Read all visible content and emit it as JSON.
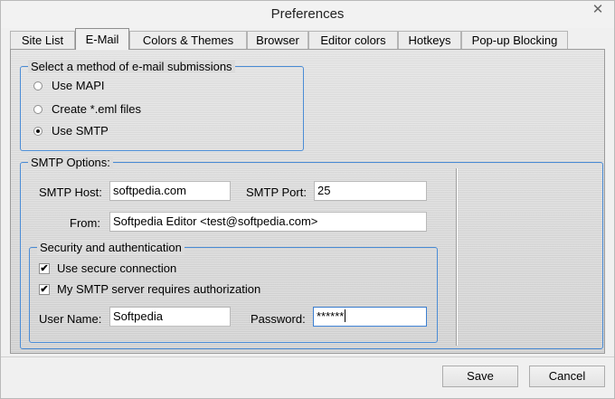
{
  "window": {
    "title": "Preferences",
    "close_glyph": "✕"
  },
  "tabs": [
    {
      "label": "Site List"
    },
    {
      "label": "E-Mail"
    },
    {
      "label": "Colors & Themes"
    },
    {
      "label": "Browser"
    },
    {
      "label": "Editor colors"
    },
    {
      "label": "Hotkeys"
    },
    {
      "label": "Pop-up Blocking"
    }
  ],
  "active_tab": "E-Mail",
  "method_group": {
    "legend": "Select a method of e-mail submissions",
    "options": [
      {
        "label": "Use MAPI",
        "selected": false
      },
      {
        "label": "Create *.eml files",
        "selected": false
      },
      {
        "label": "Use SMTP",
        "selected": true
      }
    ]
  },
  "smtp": {
    "legend": "SMTP Options:",
    "host_label": "SMTP Host:",
    "host_value": "softpedia.com",
    "port_label": "SMTP Port:",
    "port_value": "25",
    "from_label": "From:",
    "from_value": "Softpedia Editor <test@softpedia.com>"
  },
  "security": {
    "legend": "Security and authentication",
    "secure_label": "Use secure connection",
    "secure_checked": true,
    "auth_label": "My SMTP server requires authorization",
    "auth_checked": true,
    "username_label": "User Name:",
    "username_value": "Softpedia",
    "password_label": "Password:",
    "password_value": "******"
  },
  "buttons": {
    "save": "Save",
    "cancel": "Cancel"
  },
  "check_glyph": "✔"
}
